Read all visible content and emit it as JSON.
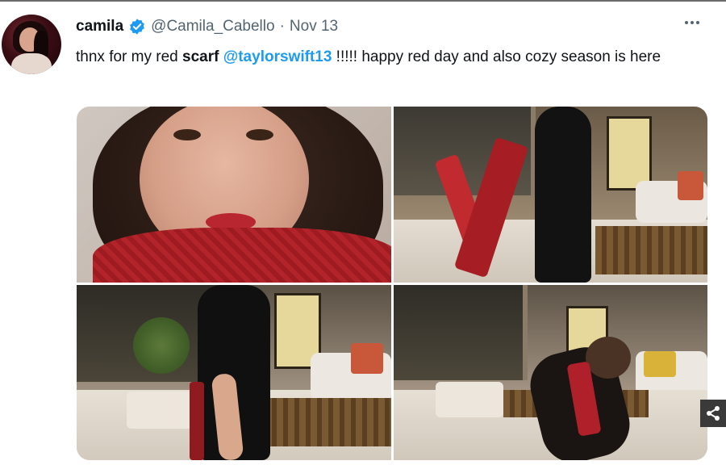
{
  "tweet": {
    "display_name": "camila",
    "handle": "@Camila_Cabello",
    "separator": "·",
    "date": "Nov 13",
    "text": {
      "part1": "thnx for my red ",
      "bold": "scarf",
      "part2": " ",
      "mention": "@taylorswift13",
      "part3": " !!!!! happy red day and also cozy season is here"
    }
  },
  "media": {
    "count": 4
  },
  "icons": {
    "verified": "verified-badge-icon",
    "more": "more-options-icon",
    "share": "share-icon"
  },
  "colors": {
    "accent": "#1d9bf0",
    "text": "#0f1419",
    "muted": "#536471"
  }
}
